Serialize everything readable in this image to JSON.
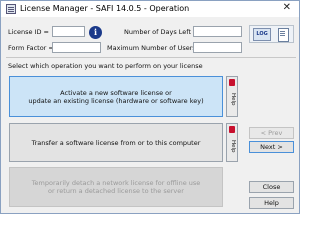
{
  "window": {
    "title": "License Manager - SAFI 14.0.5 - Operation",
    "close_glyph": "✕"
  },
  "fields": {
    "license_id": {
      "label": "License ID =",
      "value": ""
    },
    "form_factor": {
      "label": "Form Factor =",
      "value": ""
    },
    "days_left": {
      "label": "Number of Days Left =",
      "value": ""
    },
    "max_users": {
      "label": "Maximum Number of Users =",
      "value": ""
    }
  },
  "toolbar": {
    "info_glyph": "i",
    "log_label": "LOG"
  },
  "prompt": "Select which operation you want to perform on your license",
  "operations": [
    {
      "line1": "Activate a new software license or",
      "line2": "update an existing license (hardware or software key)",
      "help": "Help",
      "state": "active"
    },
    {
      "line1": "Transfer a software license from or to this computer",
      "line2": "",
      "help": "Help",
      "state": "normal"
    },
    {
      "line1": "Temporarily detach a network license for offline use",
      "line2": "or return a detached license to the server",
      "help": "",
      "state": "disabled"
    }
  ],
  "nav": {
    "prev": "< Prev",
    "next": "Next >",
    "close": "Close",
    "help": "Help"
  }
}
